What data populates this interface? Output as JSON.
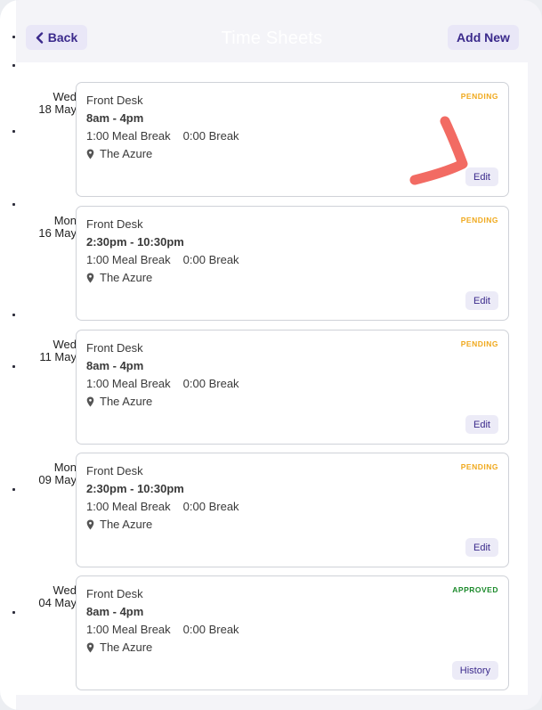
{
  "header": {
    "back_label": "Back",
    "title": "Time Sheets",
    "add_label": "Add New"
  },
  "colors": {
    "pending": "#f0a91d",
    "approved": "#1b8a2b",
    "accent": "#3b2a8c",
    "annotation": "#f26b63"
  },
  "entries": [
    {
      "day": "Wed",
      "date": "18 May",
      "position": "Front Desk",
      "time": "8am - 4pm",
      "meal_break": "1:00 Meal Break",
      "break": "0:00 Break",
      "location": "The Azure",
      "status": "PENDING",
      "action": "Edit"
    },
    {
      "day": "Mon",
      "date": "16 May",
      "position": "Front Desk",
      "time": "2:30pm - 10:30pm",
      "meal_break": "1:00 Meal Break",
      "break": "0:00 Break",
      "location": "The Azure",
      "status": "PENDING",
      "action": "Edit"
    },
    {
      "day": "Wed",
      "date": "11 May",
      "position": "Front Desk",
      "time": "8am - 4pm",
      "meal_break": "1:00 Meal Break",
      "break": "0:00 Break",
      "location": "The Azure",
      "status": "PENDING",
      "action": "Edit"
    },
    {
      "day": "Mon",
      "date": "09 May",
      "position": "Front Desk",
      "time": "2:30pm - 10:30pm",
      "meal_break": "1:00 Meal Break",
      "break": "0:00 Break",
      "location": "The Azure",
      "status": "PENDING",
      "action": "Edit"
    },
    {
      "day": "Wed",
      "date": "04 May",
      "position": "Front Desk",
      "time": "8am - 4pm",
      "meal_break": "1:00 Meal Break",
      "break": "0:00 Break",
      "location": "The Azure",
      "status": "APPROVED",
      "action": "History"
    }
  ]
}
